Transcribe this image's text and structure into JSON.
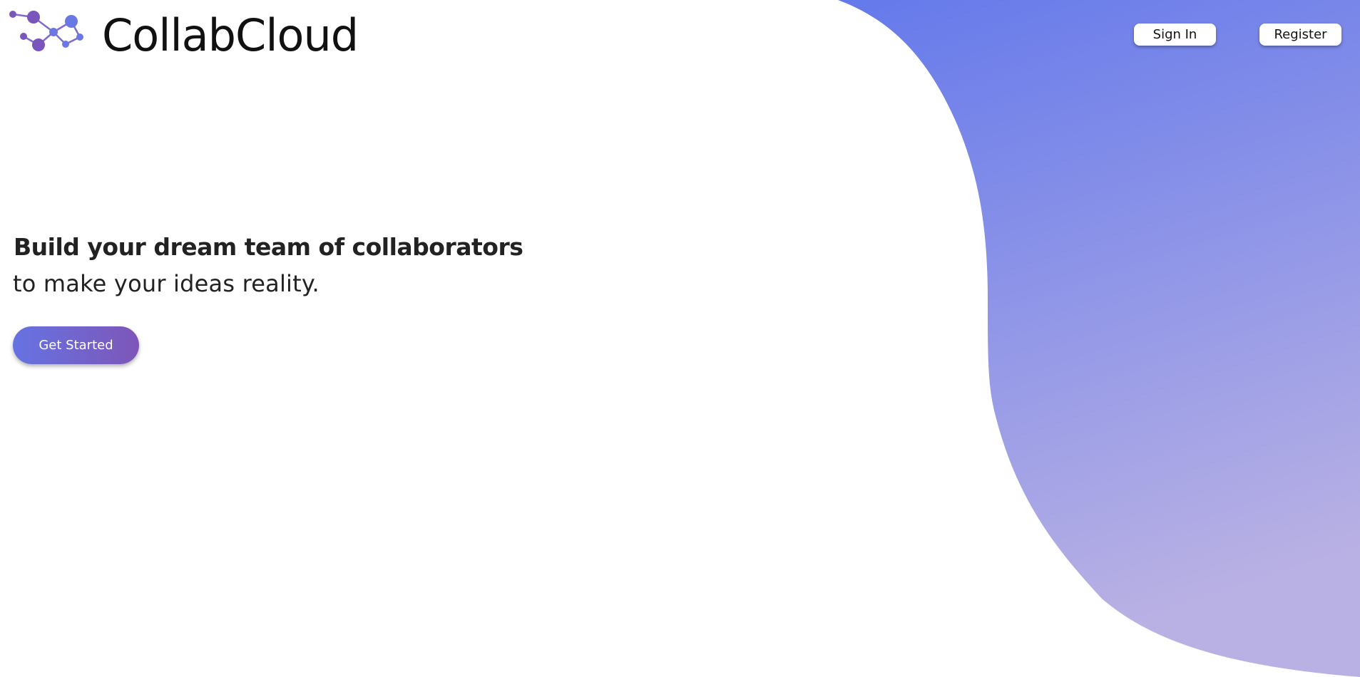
{
  "brand": {
    "name": "CollabCloud",
    "logo_icon": "network-nodes-icon"
  },
  "nav": {
    "sign_in_label": "Sign In",
    "register_label": "Register"
  },
  "hero": {
    "title": "Build your dream team of collaborators",
    "subtitle": "to make your ideas reality.",
    "cta_label": "Get Started"
  },
  "colors": {
    "blob_top": "#6479eb",
    "blob_bottom": "#b9b1e4",
    "cta_start": "#6673e2",
    "cta_end": "#7d56b8",
    "logo_purple": "#7a55bb",
    "logo_blue": "#6a78e6"
  }
}
